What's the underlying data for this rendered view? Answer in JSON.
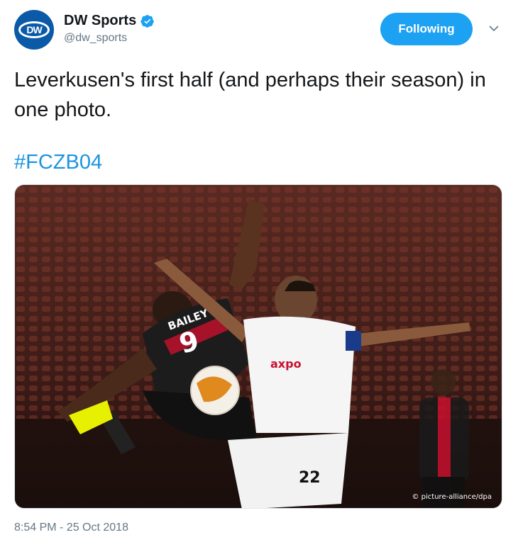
{
  "account": {
    "avatar_text": "DW",
    "display_name": "DW Sports",
    "handle": "@dw_sports",
    "verified_icon": "verified-badge-icon"
  },
  "follow_button": {
    "label": "Following"
  },
  "tweet": {
    "text": "Leverkusen's first half (and perhaps their season) in one photo.",
    "hashtag": "#FCZB04",
    "timestamp": "8:54 PM - 25 Oct 2018"
  },
  "media": {
    "credit": "© picture-alliance/dpa",
    "jersey_name": "BAILEY",
    "jersey_number_front": "9",
    "sponsor": "axpo",
    "shorts_number": "22"
  },
  "colors": {
    "brand_blue": "#1da1f2",
    "hashtag_blue": "#1b95e0",
    "dw_blue": "#0b5aa8",
    "secondary_text": "#657786"
  }
}
